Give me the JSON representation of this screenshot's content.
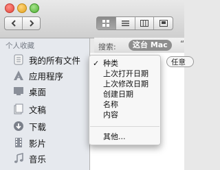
{
  "toolbar": {
    "back_icon": "chevron-left-icon",
    "forward_icon": "chevron-right-icon",
    "view_modes": [
      "icon-view-icon",
      "list-view-icon",
      "column-view-icon",
      "cover-flow-icon"
    ],
    "active_view": "icon-view-icon"
  },
  "sidebar": {
    "heading": "个人收藏",
    "items": [
      {
        "label": "我的所有文件",
        "icon": "all-files-icon"
      },
      {
        "label": "应用程序",
        "icon": "applications-icon"
      },
      {
        "label": "桌面",
        "icon": "desktop-icon"
      },
      {
        "label": "文稿",
        "icon": "documents-icon"
      },
      {
        "label": "下载",
        "icon": "downloads-icon"
      },
      {
        "label": "影片",
        "icon": "movies-icon"
      },
      {
        "label": "音乐",
        "icon": "music-icon"
      }
    ]
  },
  "search": {
    "label": "搜索:",
    "scope": "这台 Mac",
    "quote": "“",
    "any_button": "任意"
  },
  "menu": {
    "checked_index": 0,
    "items": [
      "种类",
      "上次打开日期",
      "上次修改日期",
      "创建日期",
      "名称",
      "内容"
    ],
    "other": "其他..."
  },
  "colors": {
    "sidebar_bg": "#e6e9ee",
    "scope_chip": "#8e8e8e"
  }
}
